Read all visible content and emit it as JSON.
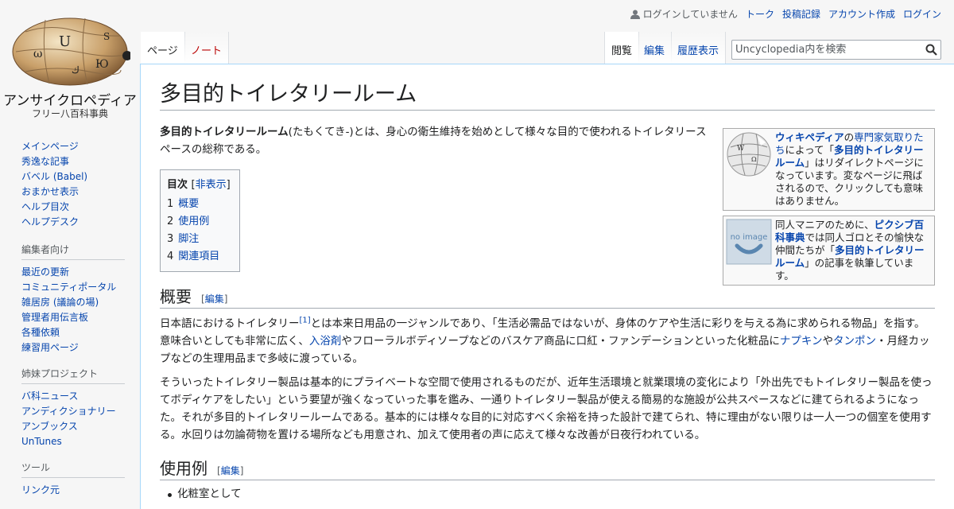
{
  "site": {
    "name": "アンサイクロペディア",
    "tagline": "フリー八百科事典"
  },
  "personal": {
    "status": "ログインしていません",
    "talk": "トーク",
    "contributions": "投稿記録",
    "create_account": "アカウント作成",
    "login": "ログイン"
  },
  "tabs": {
    "page": "ページ",
    "talk": "ノート",
    "read": "閲覧",
    "edit": "編集",
    "history": "履歴表示"
  },
  "search": {
    "placeholder": "Uncyclopedia内を検索"
  },
  "sidebar": {
    "nav": [
      "メインページ",
      "秀逸な記事",
      "バベル (Babel)",
      "おまかせ表示",
      "ヘルプ目次",
      "ヘルプデスク"
    ],
    "editors_heading": "編集者向け",
    "editors": [
      "最近の更新",
      "コミュニティポータル",
      "雑居房 (議論の場)",
      "管理者用伝言板",
      "各種依頼",
      "練習用ページ"
    ],
    "sister_heading": "姉妹プロジェクト",
    "sister": [
      "バ科ニュース",
      "アンディクショナリー",
      "アンブックス",
      "UnTunes"
    ],
    "tools_heading": "ツール",
    "tools": [
      "リンク元"
    ]
  },
  "article": {
    "title": "多目的トイレタリールーム",
    "intro_bold": "多目的トイレタリールーム",
    "intro_rest": "(たもくてき-)とは、身心の衛生維持を始めとして様々な目的で使われるトイレタリースペースの総称である。",
    "box1": {
      "link1": "ウィキペディア",
      "text1": "の",
      "link2": "専門家気取りたち",
      "text2": "によって「",
      "link3": "多目的トイレタリールーム",
      "text3": "」はリダイレクトページになっています。変なページに飛ばされるので、クリックしても意味はありません。"
    },
    "box2": {
      "text1": "同人マニアのために、",
      "link1": "ピクシブ百科事典",
      "text2": "では同人ゴロとその愉快な仲間たちが「",
      "link2": "多目的トイレタリールーム",
      "text3": "」の記事を執筆しています。",
      "image_text": "no image"
    },
    "toc": {
      "title": "目次",
      "toggle": "非表示",
      "items": [
        {
          "num": "1",
          "label": "概要"
        },
        {
          "num": "2",
          "label": "使用例"
        },
        {
          "num": "3",
          "label": "脚注"
        },
        {
          "num": "4",
          "label": "関連項目"
        }
      ]
    },
    "section1": {
      "heading": "概要",
      "edit": "編集",
      "p1_a": "日本語におけるトイレタリー",
      "p1_ref": "[1]",
      "p1_b": "とは本来日用品の一ジャンルであり、「生活必需品ではないが、身体のケアや生活に彩りを与える為に求められる物品」を指す。意味合いとしても非常に広く、",
      "p1_link1": "入浴剤",
      "p1_c": "やフローラルボディソープなどのバスケア商品に口紅・ファンデーションといった化粧品に",
      "p1_link2": "ナプキン",
      "p1_d": "や",
      "p1_link3": "タンポン",
      "p1_e": "・月経カップなどの生理用品まで多岐に渡っている。",
      "p2": "そういったトイレタリー製品は基本的にプライベートな空間で使用されるものだが、近年生活環境と就業環境の変化により「外出先でもトイレタリー製品を使ってボディケアをしたい」という要望が強くなっていった事を鑑み、一通りトイレタリー製品が使える簡易的な施設が公共スペースなどに建てられるようになった。それが多目的トイレタリールームである。基本的には様々な目的に対応すべく余裕を持った設計で建てられ、特に理由がない限りは一人一つの個室を使用する。水回りは勿論荷物を置ける場所なども用意され、加えて使用者の声に応えて様々な改善が日夜行われている。"
    },
    "section2": {
      "heading": "使用例",
      "edit": "編集",
      "items": [
        "化粧室として"
      ]
    }
  }
}
